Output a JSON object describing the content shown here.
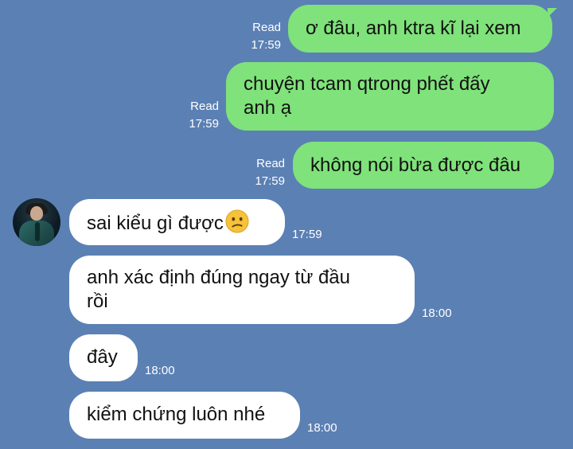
{
  "messages_out": [
    {
      "text": "ơ đâu, anh ktra kĩ lại xem",
      "status": "Read",
      "time": "17:59"
    },
    {
      "text": "chuyện tcam qtrong phết đấy\nanh ạ",
      "status": "Read",
      "time": "17:59"
    },
    {
      "text": "không nói bừa được đâu",
      "status": "Read",
      "time": "17:59"
    }
  ],
  "messages_in": [
    {
      "text": "sai kiểu gì được",
      "emoji": "confused-face-icon",
      "time": "17:59"
    },
    {
      "text": "anh xác định đúng ngay từ đầu\nrồi",
      "time": "18:00"
    },
    {
      "text": "đây",
      "time": "18:00"
    },
    {
      "text": "kiểm chứng luôn nhé",
      "time": "18:00"
    }
  ],
  "colors": {
    "background": "#5b80b4",
    "outgoing_bubble": "#7fe27a",
    "incoming_bubble": "#ffffff",
    "meta_text": "#ffffff",
    "emoji_face": "#f5c23a"
  }
}
